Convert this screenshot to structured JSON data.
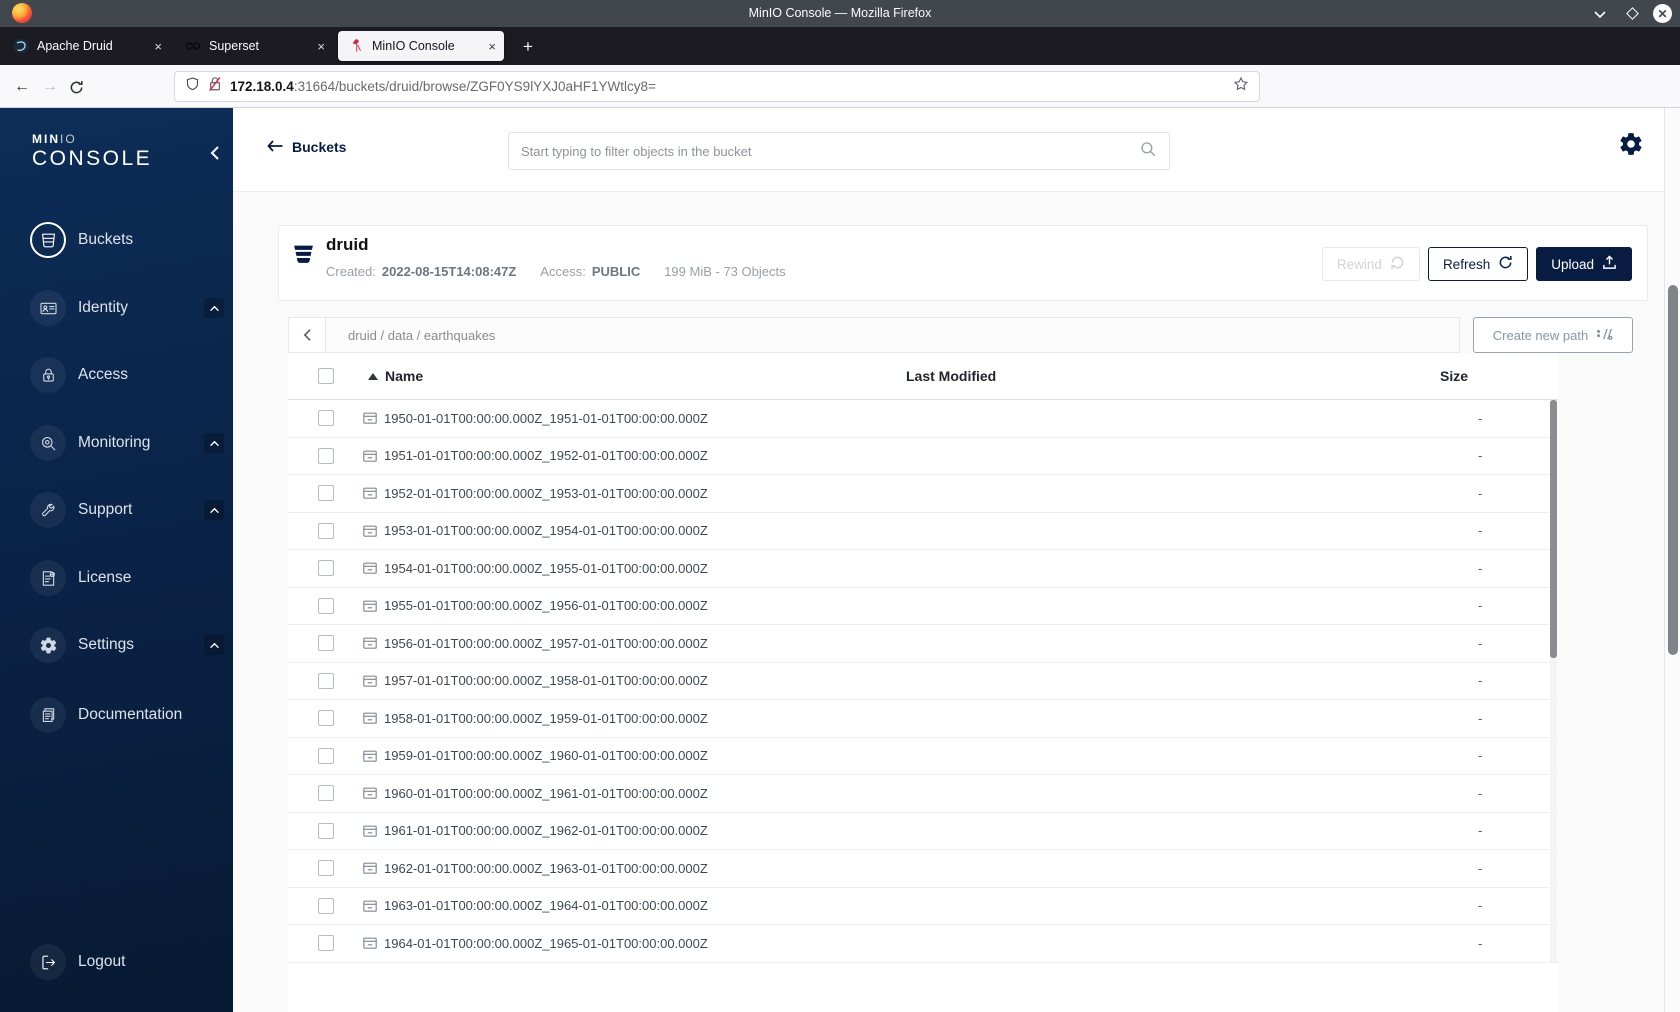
{
  "window": {
    "title": "MinIO Console — Mozilla Firefox"
  },
  "browser_chrome": {
    "tabs": [
      {
        "label": "Apache Druid",
        "favicon": "druid-favicon",
        "active": false
      },
      {
        "label": "Superset",
        "favicon": "superset-favicon",
        "active": false
      },
      {
        "label": "MinIO Console",
        "favicon": "minio-favicon",
        "active": true
      }
    ],
    "new_tab_glyph": "+",
    "close_tab_glyph": "×",
    "url": {
      "host": "172.18.0.4",
      "rest": ":31664/buckets/druid/browse/ZGF0YS9lYXJ0aHF1YWtlcy8="
    },
    "toolbar_icon_names": [
      "shield-icon",
      "lock-slash-icon",
      "star-icon",
      "pocket-icon",
      "privacy-extension-icon",
      "ublock-origin-icon",
      "cookie-extension-icon",
      "colorful-extension-icon",
      "menu-icon"
    ],
    "window_control_names": [
      "window-minimize-icon",
      "window-maximize-icon",
      "window-close-icon"
    ]
  },
  "sidebar": {
    "logo_line1_strong": "MIN",
    "logo_line1_dim": "IO",
    "logo_line2": "CONSOLE",
    "items": [
      {
        "label": "Buckets",
        "icon": "buckets-icon",
        "active": true,
        "expandable": false
      },
      {
        "label": "Identity",
        "icon": "identity-icon",
        "active": false,
        "expandable": true
      },
      {
        "label": "Access",
        "icon": "access-icon",
        "active": false,
        "expandable": false
      },
      {
        "label": "Monitoring",
        "icon": "monitoring-icon",
        "active": false,
        "expandable": true
      },
      {
        "label": "Support",
        "icon": "support-icon",
        "active": false,
        "expandable": true
      },
      {
        "label": "License",
        "icon": "license-icon",
        "active": false,
        "expandable": false
      },
      {
        "label": "Settings",
        "icon": "settings-icon",
        "active": false,
        "expandable": true
      },
      {
        "label": "Documentation",
        "icon": "documentation-icon",
        "active": false,
        "expandable": false
      }
    ],
    "logout": {
      "label": "Logout",
      "icon": "logout-icon"
    }
  },
  "header": {
    "back_label": "Buckets",
    "search_placeholder": "Start typing to filter objects in the bucket"
  },
  "bucket": {
    "name": "druid",
    "created_label": "Created:",
    "created_value": "2022-08-15T14:08:47Z",
    "access_label": "Access:",
    "access_value": "PUBLIC",
    "summary": "199 MiB - 73 Objects",
    "buttons": {
      "rewind": "Rewind",
      "refresh": "Refresh",
      "upload": "Upload"
    }
  },
  "object_browser": {
    "breadcrumb": "druid / data / earthquakes",
    "create_path_label": "Create new path",
    "columns": {
      "name": "Name",
      "last_modified": "Last Modified",
      "size": "Size"
    },
    "rows": [
      {
        "name": "1950-01-01T00:00:00.000Z_1951-01-01T00:00:00.000Z",
        "last_modified": "",
        "size": "-"
      },
      {
        "name": "1951-01-01T00:00:00.000Z_1952-01-01T00:00:00.000Z",
        "last_modified": "",
        "size": "-"
      },
      {
        "name": "1952-01-01T00:00:00.000Z_1953-01-01T00:00:00.000Z",
        "last_modified": "",
        "size": "-"
      },
      {
        "name": "1953-01-01T00:00:00.000Z_1954-01-01T00:00:00.000Z",
        "last_modified": "",
        "size": "-"
      },
      {
        "name": "1954-01-01T00:00:00.000Z_1955-01-01T00:00:00.000Z",
        "last_modified": "",
        "size": "-"
      },
      {
        "name": "1955-01-01T00:00:00.000Z_1956-01-01T00:00:00.000Z",
        "last_modified": "",
        "size": "-"
      },
      {
        "name": "1956-01-01T00:00:00.000Z_1957-01-01T00:00:00.000Z",
        "last_modified": "",
        "size": "-"
      },
      {
        "name": "1957-01-01T00:00:00.000Z_1958-01-01T00:00:00.000Z",
        "last_modified": "",
        "size": "-"
      },
      {
        "name": "1958-01-01T00:00:00.000Z_1959-01-01T00:00:00.000Z",
        "last_modified": "",
        "size": "-"
      },
      {
        "name": "1959-01-01T00:00:00.000Z_1960-01-01T00:00:00.000Z",
        "last_modified": "",
        "size": "-"
      },
      {
        "name": "1960-01-01T00:00:00.000Z_1961-01-01T00:00:00.000Z",
        "last_modified": "",
        "size": "-"
      },
      {
        "name": "1961-01-01T00:00:00.000Z_1962-01-01T00:00:00.000Z",
        "last_modified": "",
        "size": "-"
      },
      {
        "name": "1962-01-01T00:00:00.000Z_1963-01-01T00:00:00.000Z",
        "last_modified": "",
        "size": "-"
      },
      {
        "name": "1963-01-01T00:00:00.000Z_1964-01-01T00:00:00.000Z",
        "last_modified": "",
        "size": "-"
      },
      {
        "name": "1964-01-01T00:00:00.000Z_1965-01-01T00:00:00.000Z",
        "last_modified": "",
        "size": "-"
      }
    ]
  },
  "colors": {
    "brand_navy": "#081C42",
    "brand_red": "#C72C48"
  }
}
